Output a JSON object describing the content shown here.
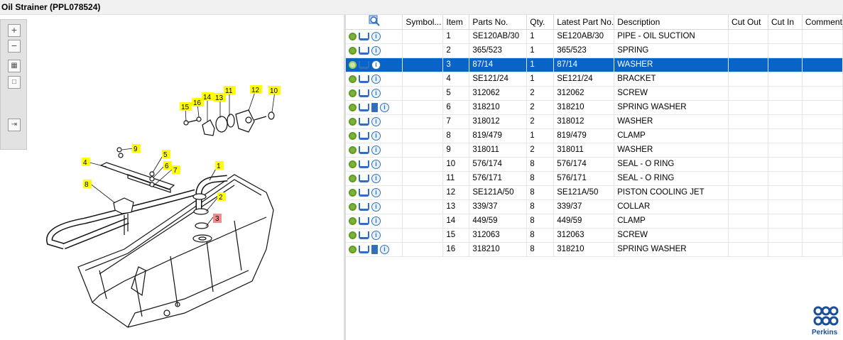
{
  "window": {
    "title": "Oil Strainer (PPL078524)"
  },
  "toolbar": {
    "icons": [
      "zoom-in-icon",
      "zoom-out-icon",
      "fit-page-icon",
      "fit-window-icon",
      "export-icon"
    ]
  },
  "diagram": {
    "callouts": [
      "1",
      "2",
      "3",
      "4",
      "5",
      "6",
      "7",
      "8",
      "9",
      "10",
      "11",
      "12",
      "13",
      "14",
      "15",
      "16"
    ],
    "highlighted_callout": "3",
    "callout_color": "#ffff00",
    "highlight_color": "#f28b8b"
  },
  "grid": {
    "columns": {
      "symbol": "Symbol...",
      "item": "Item",
      "parts_no": "Parts No.",
      "qty": "Qty.",
      "latest": "Latest Part No.",
      "description": "Description",
      "cut_out": "Cut Out",
      "cut_in": "Cut In",
      "comment": "Comment"
    },
    "selected_row": 2,
    "selection_color": "#0a64c8",
    "rows": [
      {
        "item": "1",
        "parts_no": "SE120AB/30",
        "qty": "1",
        "latest": "SE120AB/30",
        "description": "PIPE - OIL SUCTION",
        "book": false
      },
      {
        "item": "2",
        "parts_no": "365/523",
        "qty": "1",
        "latest": "365/523",
        "description": "SPRING",
        "book": false
      },
      {
        "item": "3",
        "parts_no": "87/14",
        "qty": "1",
        "latest": "87/14",
        "description": "WASHER",
        "book": false
      },
      {
        "item": "4",
        "parts_no": "SE121/24",
        "qty": "1",
        "latest": "SE121/24",
        "description": "BRACKET",
        "book": false
      },
      {
        "item": "5",
        "parts_no": "312062",
        "qty": "2",
        "latest": "312062",
        "description": "SCREW",
        "book": false
      },
      {
        "item": "6",
        "parts_no": "318210",
        "qty": "2",
        "latest": "318210",
        "description": "SPRING WASHER",
        "book": true
      },
      {
        "item": "7",
        "parts_no": "318012",
        "qty": "2",
        "latest": "318012",
        "description": "WASHER",
        "book": false
      },
      {
        "item": "8",
        "parts_no": "819/479",
        "qty": "1",
        "latest": "819/479",
        "description": "CLAMP",
        "book": false
      },
      {
        "item": "9",
        "parts_no": "318011",
        "qty": "2",
        "latest": "318011",
        "description": "WASHER",
        "book": false
      },
      {
        "item": "10",
        "parts_no": "576/174",
        "qty": "8",
        "latest": "576/174",
        "description": "SEAL - O RING",
        "book": false
      },
      {
        "item": "11",
        "parts_no": "576/171",
        "qty": "8",
        "latest": "576/171",
        "description": "SEAL - O RING",
        "book": false
      },
      {
        "item": "12",
        "parts_no": "SE121A/50",
        "qty": "8",
        "latest": "SE121A/50",
        "description": "PISTON COOLING JET",
        "book": false
      },
      {
        "item": "13",
        "parts_no": "339/37",
        "qty": "8",
        "latest": "339/37",
        "description": "COLLAR",
        "book": false
      },
      {
        "item": "14",
        "parts_no": "449/59",
        "qty": "8",
        "latest": "449/59",
        "description": "CLAMP",
        "book": false
      },
      {
        "item": "15",
        "parts_no": "312063",
        "qty": "8",
        "latest": "312063",
        "description": "SCREW",
        "book": false
      },
      {
        "item": "16",
        "parts_no": "318210",
        "qty": "8",
        "latest": "318210",
        "description": "SPRING WASHER",
        "book": true
      }
    ]
  },
  "brand": {
    "name": "Perkins",
    "color": "#1a4e9a"
  }
}
